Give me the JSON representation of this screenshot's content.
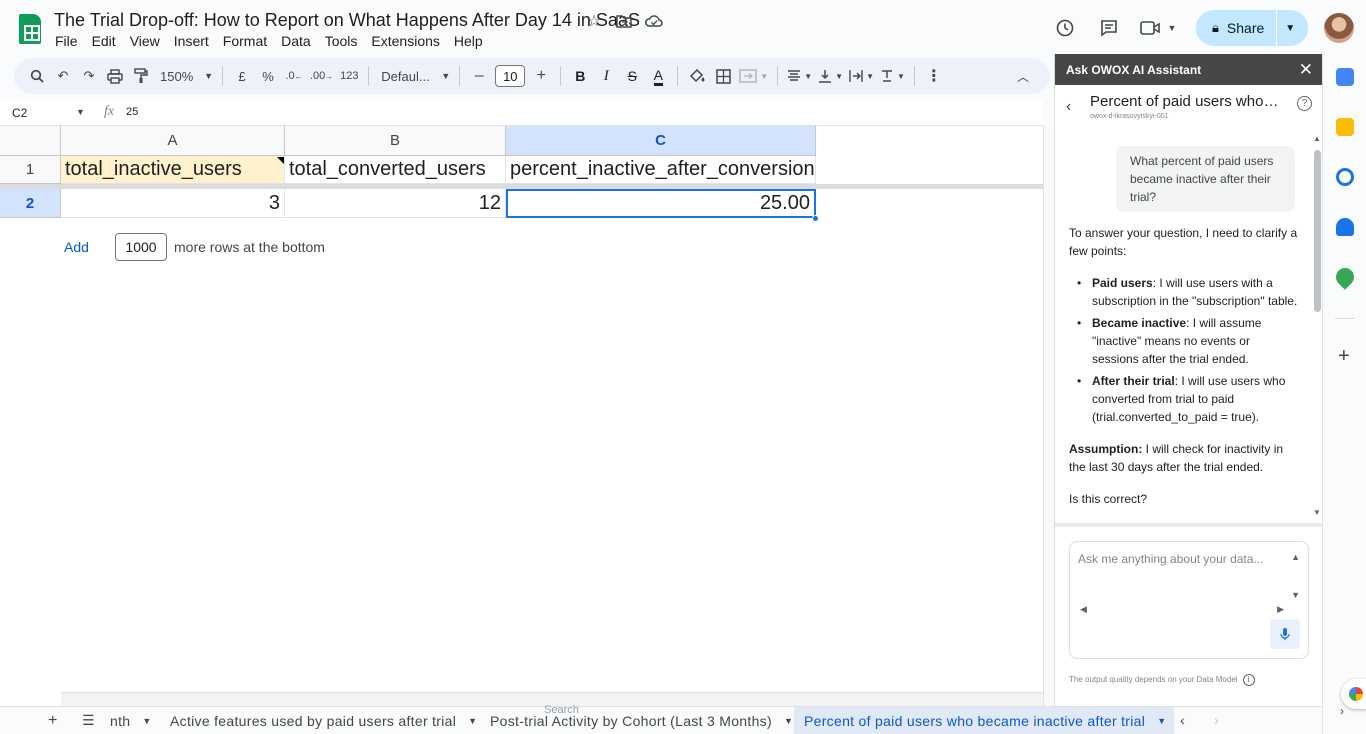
{
  "app": {
    "doc_title": "The Trial Drop-off: How to Report on What Happens After Day 14 in SaaS",
    "menu": [
      "File",
      "Edit",
      "View",
      "Insert",
      "Format",
      "Data",
      "Tools",
      "Extensions",
      "Help"
    ],
    "share_label": "Share"
  },
  "toolbar": {
    "zoom": "150%",
    "currency": "£",
    "percent": "%",
    "dec_less": ".0",
    "dec_more": ".00",
    "number_format": "123",
    "font": "Defaul...",
    "font_size": "10",
    "bold": "B",
    "italic": "I",
    "strike": "S",
    "text_color": "A",
    "minus": "–",
    "plus": "+"
  },
  "formula_bar": {
    "name_box": "C2",
    "fx": "fx",
    "value": "25"
  },
  "sheet": {
    "columns": [
      "A",
      "B",
      "C"
    ],
    "rows": [
      "1",
      "2"
    ],
    "header_row": [
      "total_inactive_users",
      "total_converted_users",
      "percent_inactive_after_conversion"
    ],
    "data_row": [
      "3",
      "12",
      "25.00"
    ],
    "add_label": "Add",
    "add_count": "1000",
    "add_suffix": "more rows at the bottom"
  },
  "tabs": {
    "items": [
      {
        "label": "nth"
      },
      {
        "label": "Active features used by paid users after trial"
      },
      {
        "label": "Post-trial Activity by Cohort (Last 3 Months)"
      },
      {
        "label": "Percent of paid users who became inactive after trial"
      }
    ],
    "search_label": "Search"
  },
  "panel": {
    "header": "Ask OWOX AI Assistant",
    "chat_title": "Percent of paid users who became inactive after trial",
    "chat_subtitle": "owox-d-ikrasovytskyi-001",
    "user_question": "What percent of paid users became inactive after their trial?",
    "intro": "To answer your question, I need to clarify a few points:",
    "points": [
      {
        "term": "Paid users",
        "text": ": I will use users with a subscription in the \"subscription\" table."
      },
      {
        "term": "Became inactive",
        "text": ": I will assume \"inactive\" means no events or sessions after the trial ended."
      },
      {
        "term": "After their trial",
        "text": ": I will use users who converted from trial to paid (trial.converted_to_paid = true)."
      }
    ],
    "assumption_term": "Assumption:",
    "assumption_text": " I will check for inactivity in the last 30 days after the trial ended.",
    "confirm": "Is this correct?",
    "input_placeholder": "Ask me anything about your data...",
    "footer": "The output quality depends on your Data Model"
  },
  "colors": {
    "accent": "#0b57d0",
    "share_bg": "#c2e7ff",
    "selected_header": "#d3e3fd",
    "highlight_cell": "#fff2cc",
    "panel_header": "#444746"
  }
}
